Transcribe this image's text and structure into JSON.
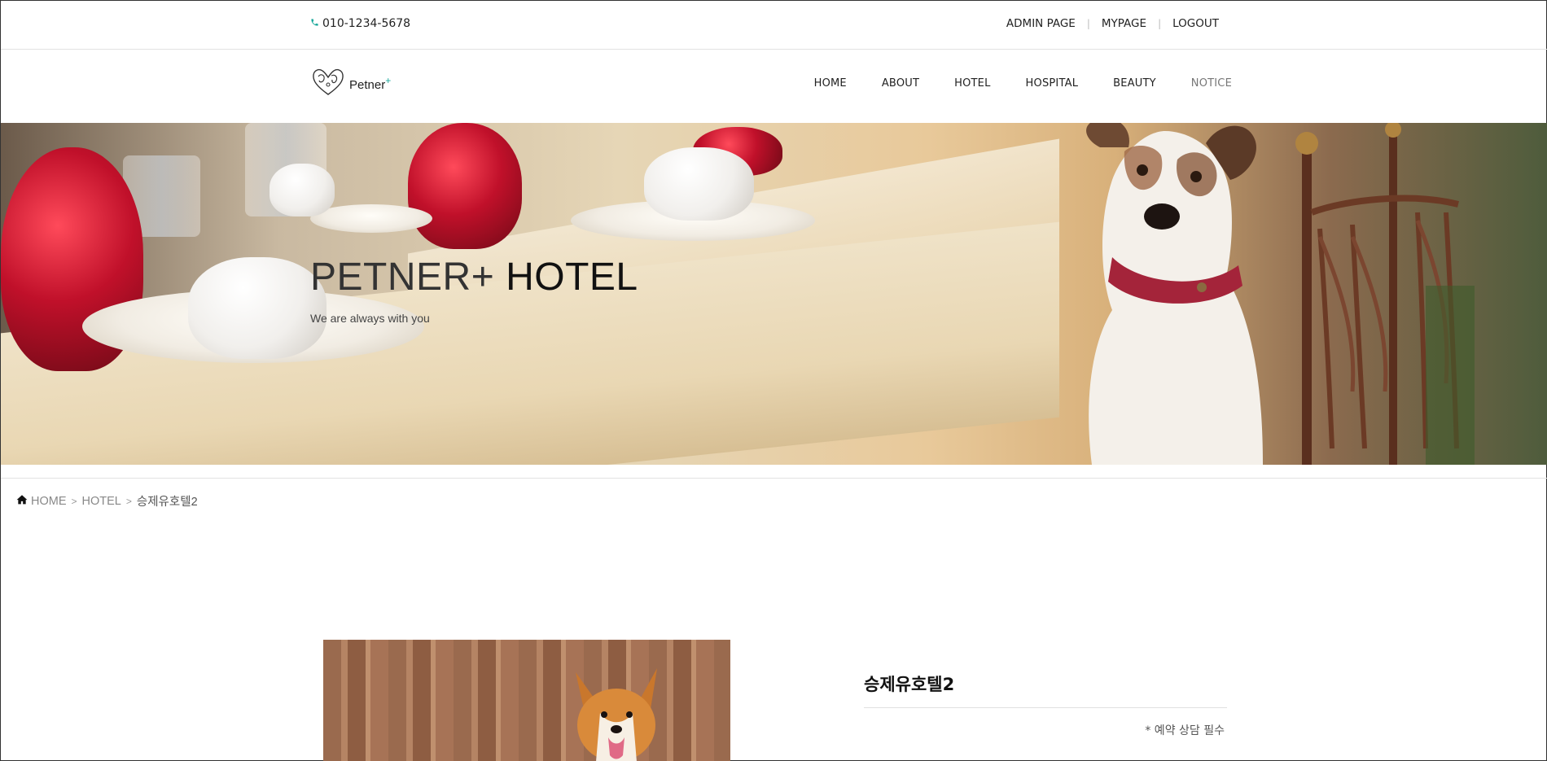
{
  "topbar": {
    "phone": "010-1234-5678",
    "links": [
      "ADMIN PAGE",
      "MYPAGE",
      "LOGOUT"
    ]
  },
  "header": {
    "logo_text": "Petner",
    "logo_plus": "+",
    "nav": [
      "HOME",
      "ABOUT",
      "HOTEL",
      "HOSPITAL",
      "BEAUTY",
      "NOTICE"
    ]
  },
  "hero": {
    "title_light": "PETNER+",
    "title_bold": "HOTEL",
    "subtitle": "We are always with you"
  },
  "breadcrumb": {
    "home": "HOME",
    "section": "HOTEL",
    "current": "승제유호텔2"
  },
  "product": {
    "name": "승제유호텔2",
    "note": "* 예약 상담 필수"
  },
  "colors": {
    "accent": "#1aa89b",
    "text": "#222222",
    "muted_nav": "#777777"
  },
  "icons": {
    "phone": "phone-icon",
    "home": "home-icon",
    "logo": "heart-paw-logo-icon"
  }
}
